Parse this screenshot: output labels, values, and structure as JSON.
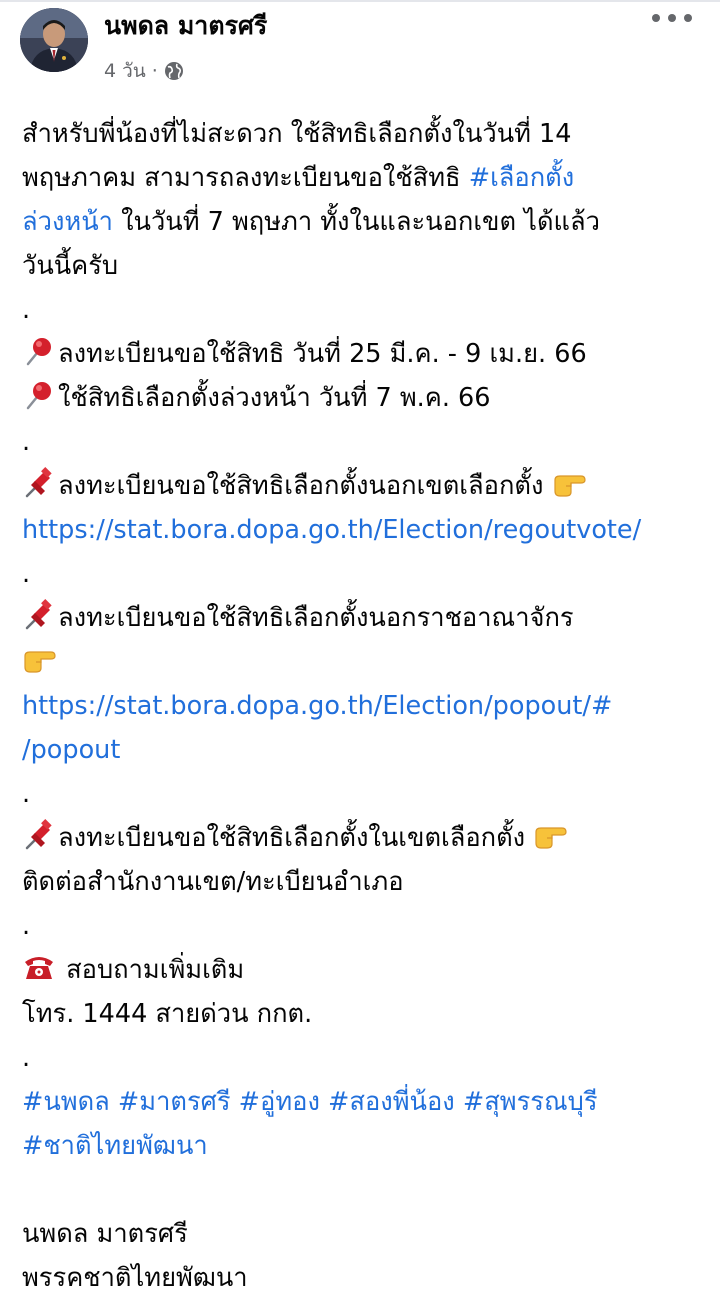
{
  "post": {
    "author": "นพดล มาตรศรี",
    "time": "4 วัน",
    "separator": "·",
    "paragraph1_line1": "สำหรับพี่น้องที่ไม่สะดวก ใช้สิทธิเลือกตั้งในวันที่ 14",
    "paragraph1_line2_text": "พฤษภาคม สามารถลงทะเบียนขอใช้สิทธิ ",
    "paragraph1_hashtag_part1": "#เลือกตั้ง",
    "paragraph1_hashtag_part2": "ล่วงหน้า",
    "paragraph1_line3_text": " ในวันที่ 7 พฤษภา ทั้งในและนอกเขต ได้แล้ว",
    "paragraph1_line4": "วันนี้ครับ",
    "dot": ".",
    "register_period": "ลงทะเบียนขอใช้สิทธิ วันที่ 25 มี.ค. -  9 เม.ย. 66",
    "advance_vote_date": "ใช้สิทธิเลือกตั้งล่วงหน้า วันที่ 7 พ.ค. 66",
    "outside_district_label": "ลงทะเบียนขอใช้สิทธิเลือกตั้งนอกเขตเลือกตั้ง ",
    "outside_district_link": "https://stat.bora.dopa.go.th/Election/regoutvote/",
    "outside_kingdom_label": "ลงทะเบียนขอใช้สิทธิเลือกตั้งนอกราชอาณาจักร",
    "outside_kingdom_link_part1": "https://stat.bora.dopa.go.th/Election/popout/#",
    "outside_kingdom_link_part2": "/popout",
    "inside_district_label": "ลงทะเบียนขอใช้สิทธิเลือกตั้งในเขตเลือกตั้ง ",
    "inside_district_contact": "ติดต่อสำนักงานเขต/ทะเบียนอำเภอ",
    "inquiry_label": " สอบถามเพิ่มเติม",
    "inquiry_phone": "โทร. 1444  สายด่วน กกต.",
    "hashtags": [
      "#นพดล",
      "#มาตรศรี",
      "#อู่ทอง",
      "#สองพี่น้อง",
      "#สุพรรณบุรี"
    ],
    "hashtag_line2": "#ชาติไทยพัฒนา",
    "signature_name": "นพดล มาตรศรี",
    "signature_party": "พรรคชาติไทยพัฒนา"
  },
  "icons": {
    "header": [
      "globe-icon",
      "more-options-icon"
    ],
    "emoji": [
      "round-pushpin-icon",
      "pushpin-icon",
      "pointing-right-icon",
      "telephone-icon"
    ]
  },
  "colors": {
    "link": "#216fdb",
    "text": "#050505",
    "meta": "#65676b"
  }
}
